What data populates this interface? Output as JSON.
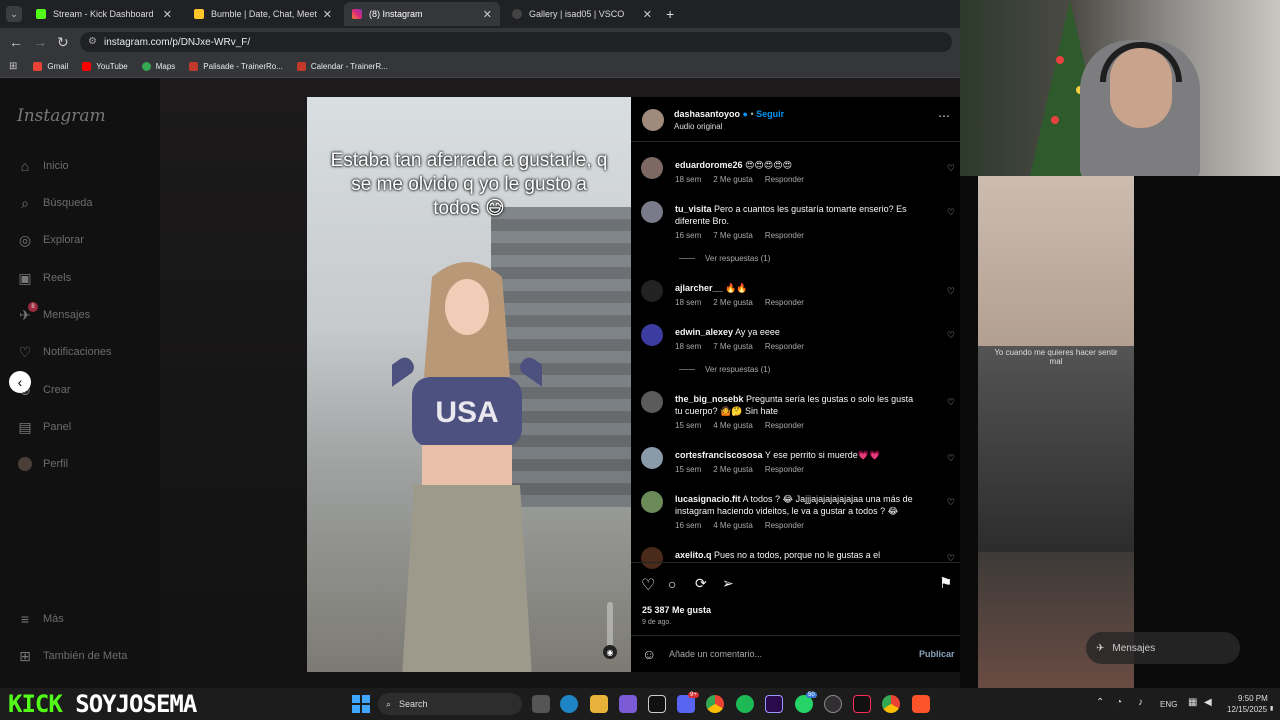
{
  "browser": {
    "tabs": [
      {
        "title": "Stream - Kick Dashboard",
        "color": "#53fc18",
        "active": false
      },
      {
        "title": "Bumble | Date, Chat, Meet New",
        "color": "#ffc629",
        "active": false
      },
      {
        "title": "(8) Instagram",
        "color": "#e1306c",
        "active": true
      },
      {
        "title": "Gallery | isad05 | VSCO",
        "color": "#444444",
        "active": false
      }
    ],
    "url": "instagram.com/p/DNJxe-WRv_F/",
    "bookmarks": [
      {
        "label": "Gmail",
        "color": "#ea4335"
      },
      {
        "label": "YouTube",
        "color": "#ff0000"
      },
      {
        "label": "Maps",
        "color": "#34a853"
      },
      {
        "label": "Palisade - TrainerRo...",
        "color": "#c0392b"
      },
      {
        "label": "Calendar - TrainerR...",
        "color": "#c0392b"
      }
    ]
  },
  "instagram": {
    "logo": "Instagram",
    "nav": [
      {
        "label": "Inicio",
        "icon": "home-icon",
        "glyph": "⌂"
      },
      {
        "label": "Búsqueda",
        "icon": "search-icon",
        "glyph": "⌕"
      },
      {
        "label": "Explorar",
        "icon": "compass-icon",
        "glyph": "◎"
      },
      {
        "label": "Reels",
        "icon": "reels-icon",
        "glyph": "▣"
      },
      {
        "label": "Mensajes",
        "icon": "messenger-icon",
        "glyph": "✈"
      },
      {
        "label": "Notificaciones",
        "icon": "heart-icon",
        "glyph": "♡"
      },
      {
        "label": "Crear",
        "icon": "plus-icon",
        "glyph": "⊕"
      },
      {
        "label": "Panel",
        "icon": "dashboard-icon",
        "glyph": "▤"
      },
      {
        "label": "Perfil",
        "icon": "avatar-icon",
        "glyph": "●"
      }
    ],
    "nav_bottom": [
      {
        "label": "Más",
        "icon": "menu-icon",
        "glyph": "≡"
      },
      {
        "label": "También de Meta",
        "icon": "meta-icon",
        "glyph": "⊞"
      }
    ],
    "messages_badge": "8",
    "video_caption": "Estaba tan aferrada a gustarle, q se me olvido q yo le gusto a todos 😅",
    "post": {
      "username": "dashasantoyoo",
      "follow": "Seguir",
      "audio": "Audio original",
      "likes": "25 387 Me gusta",
      "date": "9 de ago.",
      "comment_placeholder": "Añade un comentario...",
      "publish": "Publicar"
    },
    "comments": [
      {
        "user": "eduardorome26",
        "text": "😍😍😍😍😍",
        "time": "18 sem",
        "likes": "2 Me gusta",
        "reply": "Responder",
        "view_replies": ""
      },
      {
        "user": "tu_visita",
        "text": "Pero a cuantos les gustaría tomarte enserio? Es diferente Bro.",
        "time": "16 sem",
        "likes": "7 Me gusta",
        "reply": "Responder",
        "view_replies": "Ver respuestas (1)"
      },
      {
        "user": "ajlarcher__",
        "text": "🔥🔥",
        "time": "18 sem",
        "likes": "2 Me gusta",
        "reply": "Responder",
        "view_replies": ""
      },
      {
        "user": "edwin_alexey",
        "text": "Ay ya eeee",
        "time": "18 sem",
        "likes": "7 Me gusta",
        "reply": "Responder",
        "view_replies": "Ver respuestas (1)"
      },
      {
        "user": "the_big_nosebk",
        "text": "Pregunta sería les gustas o solo les gusta tu cuerpo? 🤷🤔 Sin hate",
        "time": "15 sem",
        "likes": "4 Me gusta",
        "reply": "Responder",
        "view_replies": ""
      },
      {
        "user": "cortesfranciscososa",
        "text": "Y ese perrito si muerde💗💗",
        "time": "15 sem",
        "likes": "2 Me gusta",
        "reply": "Responder",
        "view_replies": ""
      },
      {
        "user": "lucasignacio.fit",
        "text": "A todos ? 😂 Jajjjajajajajajajaa una más de instagram haciendo videitos, le va a gustar a todos ? 😂",
        "time": "16 sem",
        "likes": "4 Me gusta",
        "reply": "Responder",
        "view_replies": ""
      },
      {
        "user": "axelito.q",
        "text": "Pues no a todos, porque no le gustas a el",
        "time": "",
        "likes": "",
        "reply": "",
        "view_replies": ""
      }
    ]
  },
  "stream": {
    "overlay_text": "Yo cuando me quieres hacer sentir mal",
    "messages_label": "Mensajes"
  },
  "taskbar": {
    "brand_left": "KICK",
    "brand_right": "SOYJOSEMA",
    "search": "Search",
    "lang": "ENG",
    "time": "9:50 PM",
    "date": "12/15/2025",
    "badge_discord": "9+",
    "badge_whatsapp": "50"
  }
}
